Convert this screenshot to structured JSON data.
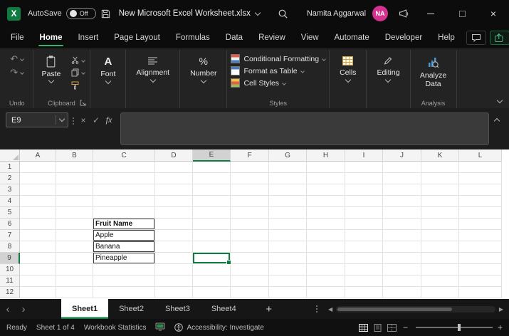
{
  "titlebar": {
    "autosave_label": "AutoSave",
    "autosave_state": "Off",
    "document_title": "New Microsoft Excel Worksheet.xlsx",
    "user_name": "Namita Aggarwal",
    "user_initials": "NA"
  },
  "menu": {
    "tabs": [
      {
        "label": "File",
        "active": false
      },
      {
        "label": "Home",
        "active": true
      },
      {
        "label": "Insert",
        "active": false
      },
      {
        "label": "Page Layout",
        "active": false
      },
      {
        "label": "Formulas",
        "active": false
      },
      {
        "label": "Data",
        "active": false
      },
      {
        "label": "Review",
        "active": false
      },
      {
        "label": "View",
        "active": false
      },
      {
        "label": "Automate",
        "active": false
      },
      {
        "label": "Developer",
        "active": false
      },
      {
        "label": "Help",
        "active": false
      }
    ]
  },
  "ribbon": {
    "paste_label": "Paste",
    "font_label": "Font",
    "alignment_label": "Alignment",
    "number_label": "Number",
    "styles_items": [
      "Conditional Formatting",
      "Format as Table",
      "Cell Styles"
    ],
    "cells_label": "Cells",
    "editing_label": "Editing",
    "analyze_label": "Analyze Data",
    "group_labels": {
      "undo": "Undo",
      "clipboard": "Clipboard",
      "styles": "Styles",
      "analysis": "Analysis"
    }
  },
  "formula_bar": {
    "name_box": "E9",
    "fx_label": "fx",
    "formula": ""
  },
  "grid": {
    "columns": [
      "A",
      "B",
      "C",
      "D",
      "E",
      "F",
      "G",
      "H",
      "I",
      "J",
      "K",
      "L"
    ],
    "rows": [
      "1",
      "2",
      "3",
      "4",
      "5",
      "6",
      "7",
      "8",
      "9",
      "10",
      "11",
      "12"
    ],
    "selected_cell": "E9",
    "cells": [
      {
        "ref": "C6",
        "text": "Fruit Name",
        "bold": true,
        "bordered": true
      },
      {
        "ref": "C7",
        "text": "Apple",
        "bold": false,
        "bordered": true
      },
      {
        "ref": "C8",
        "text": "Banana",
        "bold": false,
        "bordered": true
      },
      {
        "ref": "C9",
        "text": "Pineapple",
        "bold": false,
        "bordered": true
      }
    ]
  },
  "sheet_tabs": [
    {
      "label": "Sheet1",
      "active": true
    },
    {
      "label": "Sheet2",
      "active": false
    },
    {
      "label": "Sheet3",
      "active": false
    },
    {
      "label": "Sheet4",
      "active": false
    }
  ],
  "status_bar": {
    "ready": "Ready",
    "sheet_info": "Sheet 1 of 4",
    "workbook_statistics": "Workbook Statistics",
    "accessibility": "Accessibility: Investigate"
  },
  "colors": {
    "accent_green": "#107C41",
    "active_underline": "#35B36B",
    "avatar_pink": "#D5318F"
  }
}
